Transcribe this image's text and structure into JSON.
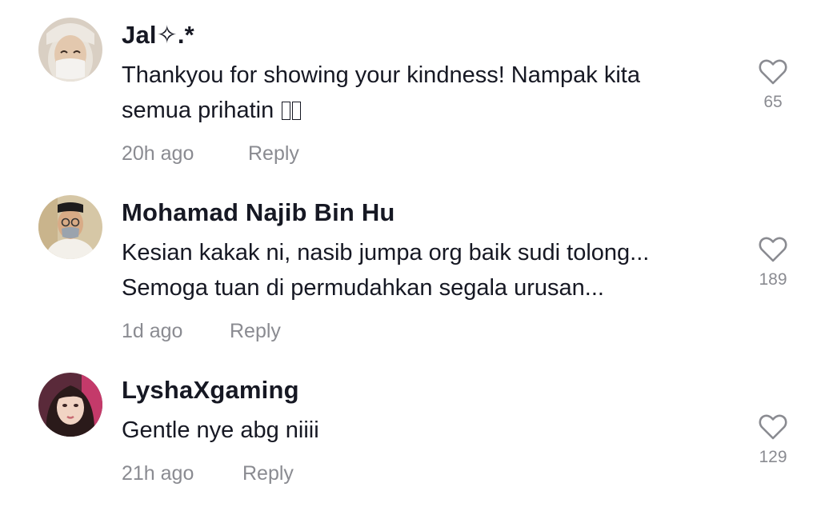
{
  "comments": [
    {
      "username": "Jal✧.*",
      "text_lines": [
        "Thankyou for showing your kindness! Nampak kita",
        "semua prihatin"
      ],
      "time": "20h ago",
      "reply_label": "Reply",
      "likes": "65",
      "avatar_icon": "avatar-masked-woman"
    },
    {
      "username": "Mohamad Najib Bin Hu",
      "text_lines": [
        "Kesian kakak ni, nasib jumpa org baik sudi tolong...",
        "Semoga tuan di permudahkan segala urusan..."
      ],
      "time": "1d ago",
      "reply_label": "Reply",
      "likes": "189",
      "avatar_icon": "avatar-man-with-songkok"
    },
    {
      "username": "LyshaXgaming",
      "text_lines": [
        "Gentle nye abg niiii"
      ],
      "time": "21h ago",
      "reply_label": "Reply",
      "likes": "129",
      "avatar_icon": "avatar-young-woman"
    }
  ],
  "colors": {
    "text": "#161823",
    "muted": "#8a8b91",
    "background": "#ffffff"
  }
}
